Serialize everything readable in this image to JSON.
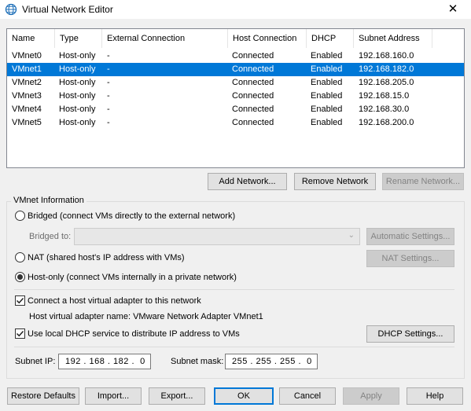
{
  "window": {
    "title": "Virtual Network Editor",
    "close_glyph": "✕",
    "icon": "globe-icon"
  },
  "list": {
    "columns": [
      "Name",
      "Type",
      "External Connection",
      "Host Connection",
      "DHCP",
      "Subnet Address"
    ],
    "rows": [
      [
        "VMnet0",
        "Host-only",
        "-",
        "Connected",
        "Enabled",
        "192.168.160.0"
      ],
      [
        "VMnet1",
        "Host-only",
        "-",
        "Connected",
        "Enabled",
        "192.168.182.0"
      ],
      [
        "VMnet2",
        "Host-only",
        "-",
        "Connected",
        "Enabled",
        "192.168.205.0"
      ],
      [
        "VMnet3",
        "Host-only",
        "-",
        "Connected",
        "Enabled",
        "192.168.15.0"
      ],
      [
        "VMnet4",
        "Host-only",
        "-",
        "Connected",
        "Enabled",
        "192.168.30.0"
      ],
      [
        "VMnet5",
        "Host-only",
        "-",
        "Connected",
        "Enabled",
        "192.168.200.0"
      ]
    ],
    "selected_row": "VMnet1"
  },
  "list_buttons": {
    "add": "Add Network...",
    "remove": "Remove Network",
    "rename": "Rename Network..."
  },
  "vmnet_info": {
    "group_label": "VMnet Information",
    "bridged_label": "Bridged (connect VMs directly to the external network)",
    "bridged_to_label": "Bridged to:",
    "bridged_to_value": "",
    "automatic_settings": "Automatic Settings...",
    "nat_label": "NAT (shared host's IP address with VMs)",
    "nat_settings": "NAT Settings...",
    "hostonly_label": "Host-only (connect VMs internally in a private network)",
    "selected_mode": "Host-only",
    "connect_adapter_label": "Connect a host virtual adapter to this network",
    "connect_adapter_checked": true,
    "adapter_name_text": "Host virtual adapter name: VMware Network Adapter VMnet1",
    "use_dhcp_label": "Use local DHCP service to distribute IP address to VMs",
    "use_dhcp_checked": true,
    "dhcp_settings": "DHCP Settings...",
    "subnet_ip_label": "Subnet IP:",
    "subnet_ip_value": "192 . 168 . 182 .  0",
    "subnet_mask_label": "Subnet mask:",
    "subnet_mask_value": "255 . 255 . 255 .  0"
  },
  "footer": {
    "restore": "Restore Defaults",
    "import": "Import...",
    "export": "Export...",
    "ok": "OK",
    "cancel": "Cancel",
    "apply": "Apply",
    "help": "Help"
  },
  "colors": {
    "selection": "#0078d7",
    "window_bg": "#f0f0f0"
  }
}
